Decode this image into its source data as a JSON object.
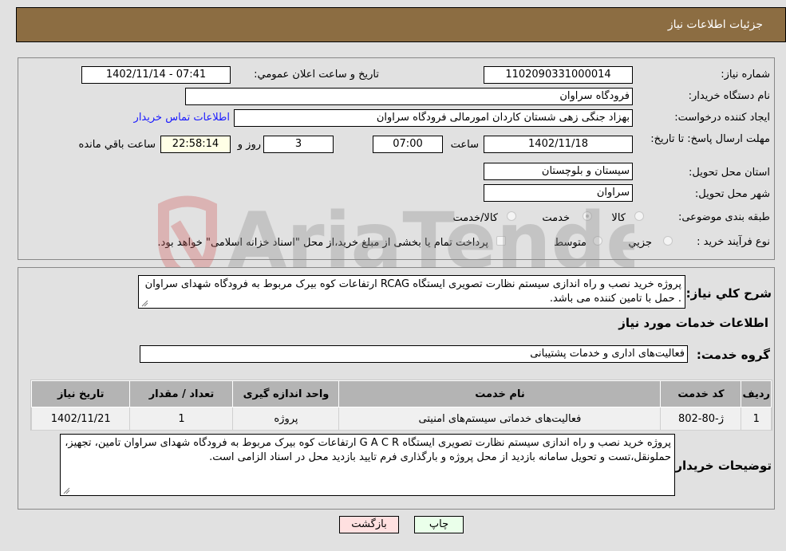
{
  "header": {
    "title": "جزئیات اطلاعات نیاز"
  },
  "form": {
    "need_number": {
      "label": "شماره نیاز:",
      "value": "1102090331000014"
    },
    "announce_datetime": {
      "label": "تاریخ و ساعت اعلان عمومي:",
      "value": "1402/11/14 - 07:41"
    },
    "buyer_org": {
      "label": "نام دستگاه خریدار:",
      "value": "فرودگاه سراوان"
    },
    "requester": {
      "label": "ایجاد کننده درخواست:",
      "value": "بهزاد جنگی زهی شستان کاردان امورمالی فرودگاه سراوان"
    },
    "buyer_contact_link": "اطلاعات تماس خریدار",
    "deadline": {
      "label": "مهلت ارسال پاسخ: تا تاریخ:",
      "date": "1402/11/18",
      "time_label": "ساعت",
      "time": "07:00",
      "days": "3",
      "days_label": "روز و",
      "remaining": "22:58:14",
      "remaining_label": "ساعت باقي مانده"
    },
    "province": {
      "label": "استان محل تحویل:",
      "value": "سیستان و بلوچستان"
    },
    "city": {
      "label": "شهر محل تحویل:",
      "value": "سراوان"
    },
    "category": {
      "label": "طبقه بندی موضوعی:",
      "options": [
        "کالا",
        "خدمت",
        "کالا/خدمت"
      ],
      "selected": "خدمت"
    },
    "purchase_type": {
      "label": "نوع فرآیند خرید :",
      "options": [
        "جزيي",
        "متوسط"
      ],
      "treasury_note": "پرداخت تمام یا بخشی از مبلغ خرید،از محل \"اسناد خزانه اسلامی\" خواهد بود."
    }
  },
  "description": {
    "label": "شرح کلي نیاز:",
    "value": "پروژه خرید نصب و راه اندازی سیستم نظارت تصویری ایستگاه RCAG ارتفاعات کوه بیرک مربوط به فرودگاه شهدای سراوان . حمل با تامین کننده می باشد."
  },
  "services": {
    "section_title": "اطلاعات خدمات مورد نیاز",
    "group_label": "گروه خدمت:",
    "group_value": "فعالیت‌های اداری و خدمات پشتیبانی",
    "columns": [
      "ردیف",
      "کد خدمت",
      "نام خدمت",
      "واحد اندازه گیری",
      "تعداد / مقدار",
      "تاریخ نیاز"
    ],
    "rows": [
      [
        "1",
        "ژ-80-802",
        "فعالیت‌های خدماتی سیستم‌های امنیتی",
        "پروژه",
        "1",
        "1402/11/21"
      ]
    ]
  },
  "buyer_notes": {
    "label": "توضیحات خریدار:",
    "value": "پروژه خرید نصب و راه اندازی سیستم نظارت تصویری ایستگاه G A C R ارتفاعات کوه بیرک مربوط به فرودگاه شهدای سراوان تامین، تجهیز، حملونقل،تست و تحویل سامانه بازدید از محل پروژه و بارگذاری فرم تایید بازدید محل در اسناد الزامی است."
  },
  "buttons": {
    "print": "چاپ",
    "back": "بازگشت"
  },
  "watermark": "AriaTender.neT",
  "colors": {
    "header_bg": "#8c6d42",
    "print_bg": "#eaffea",
    "back_bg": "#ffe0e0",
    "link": "#1a1aff"
  }
}
